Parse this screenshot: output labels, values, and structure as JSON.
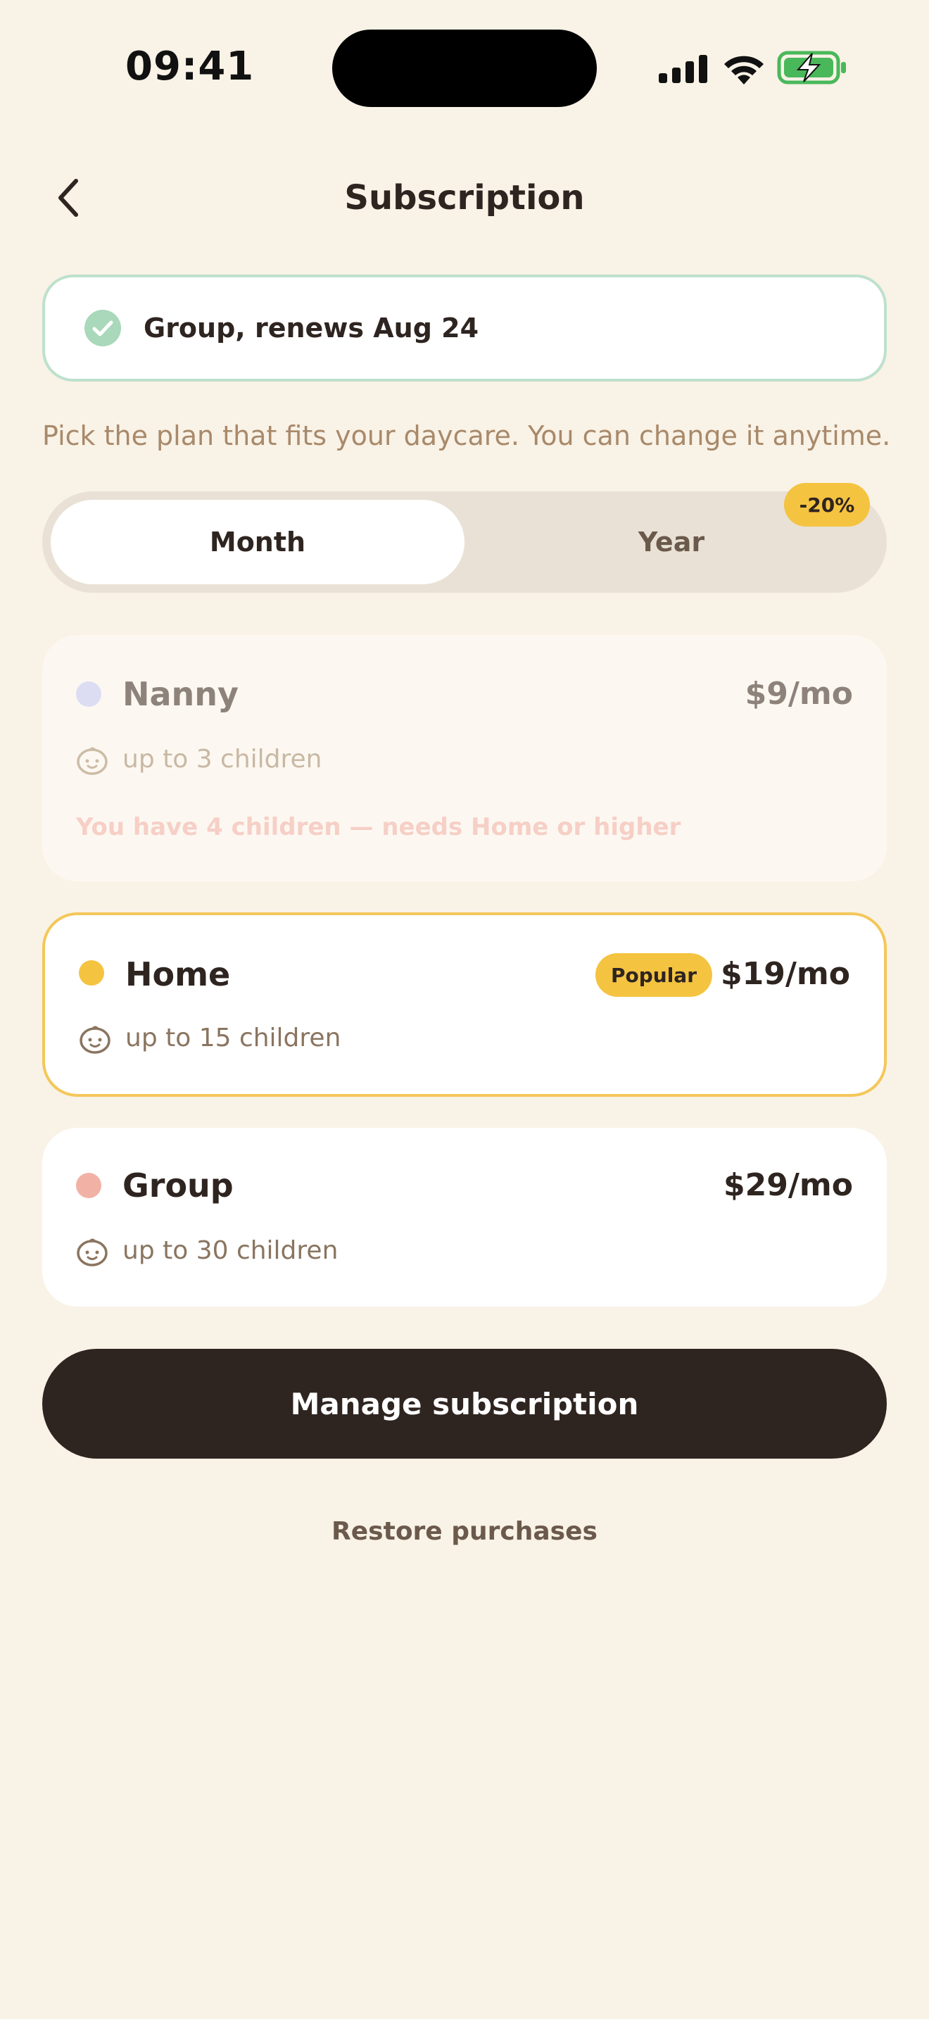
{
  "status_bar": {
    "time": "09:41",
    "icons": [
      "signal-icon",
      "wifi-icon",
      "battery-charging-icon"
    ]
  },
  "header": {
    "back_icon": "chevron-left-icon",
    "title": "Subscription"
  },
  "current_plan": {
    "icon": "check-circle-icon",
    "label": "Group, renews Aug 24"
  },
  "intro": "Pick the plan that fits your daycare. You can change it anytime.",
  "billing_toggle": {
    "options": [
      "Month",
      "Year"
    ],
    "selected": "Month",
    "year_discount": "-20%"
  },
  "plans": [
    {
      "name": "Nanny",
      "price": "$9/mo",
      "detail": "up to 3 children",
      "dot_color": "#DCDDF3",
      "disabled": true,
      "warning": "You have 4 children — needs Home or higher"
    },
    {
      "name": "Home",
      "price": "$19/mo",
      "detail": "up to 15 children",
      "dot_color": "#F4C340",
      "badge": "Popular",
      "selected": true
    },
    {
      "name": "Group",
      "price": "$29/mo",
      "detail": "up to 30 children",
      "dot_color": "#F1B2A5"
    }
  ],
  "actions": {
    "primary": "Manage subscription",
    "secondary": "Restore purchases"
  },
  "colors": {
    "background": "#F9F2E6",
    "primary_dark": "#2E2420",
    "accent_yellow": "#F4C340",
    "success_green": "#BDE1CC",
    "muted_brown": "#A8896A"
  }
}
